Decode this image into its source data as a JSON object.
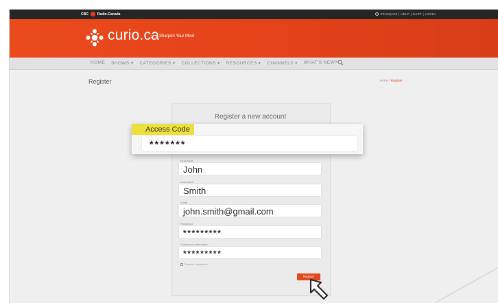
{
  "topbar": {
    "brand": "CBC",
    "brand2": "Radio-Canada",
    "utility": "FRANÇAIS | HELP | CART | LOGIN"
  },
  "banner": {
    "logo": "curio.ca",
    "separator": ">",
    "tagline": "Sharpen Your Mind"
  },
  "nav": {
    "items": [
      "HOME",
      "SHOWS ▾",
      "CATEGORIES ▾",
      "COLLECTIONS ▾",
      "RESOURCES ▾",
      "CHANNELS ▾",
      "WHAT'S NEW?"
    ]
  },
  "page": {
    "heading": "Register",
    "breadcrumb_home": "Home",
    "breadcrumb_sep": " / ",
    "breadcrumb_current": "Register"
  },
  "form": {
    "title": "Register a new account",
    "access_code_label": "Access Code",
    "access_code_value": "*******",
    "first_name_label": "First name",
    "first_name_value": "John",
    "last_name_label": "Last name",
    "last_name_value": "Smith",
    "email_label": "Email",
    "email_value": "john.smith@gmail.com",
    "password_label": "Password",
    "password_value": "*********",
    "password_confirm_label": "Password confirmation",
    "password_confirm_value": "*********",
    "newsletter_label": "Receive newsletter",
    "register_button": "Register"
  },
  "colors": {
    "brand": "#e4461c",
    "highlight": "#ede03a"
  },
  "icons": {
    "logo": "cbc-gem-icon",
    "search": "search-icon",
    "cursor": "cursor-arrow-icon",
    "globe": "globe-icon"
  }
}
